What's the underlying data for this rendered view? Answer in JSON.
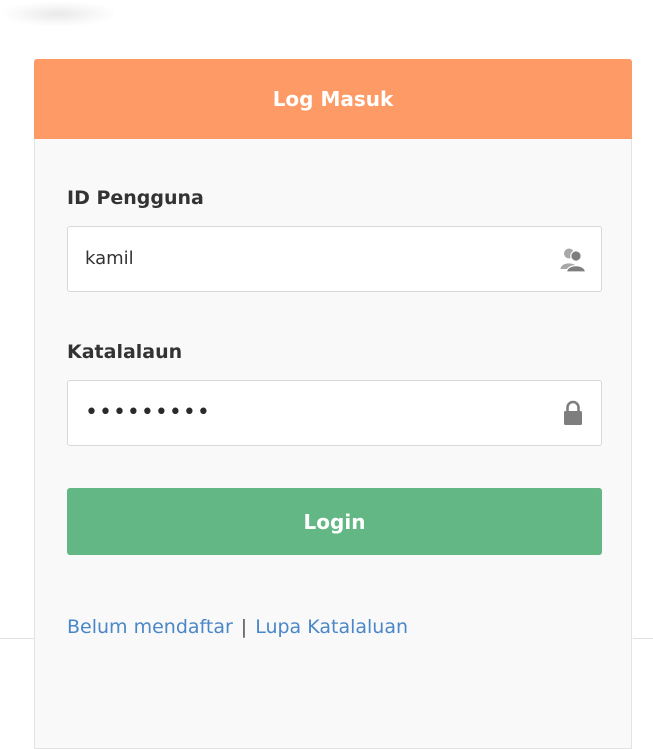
{
  "panel": {
    "title": "Log Masuk"
  },
  "form": {
    "username": {
      "label": "ID Pengguna",
      "value": "kamil",
      "icon": "users-icon"
    },
    "password": {
      "label": "Katalalaun",
      "value": "•••••••••",
      "icon": "lock-icon"
    },
    "submit_label": "Login"
  },
  "links": {
    "register": "Belum mendaftar",
    "separator": "|",
    "forgot": "Lupa Katalaluan"
  },
  "colors": {
    "header": "#fe9a66",
    "button": "#62b785",
    "link": "#4a87c8"
  }
}
